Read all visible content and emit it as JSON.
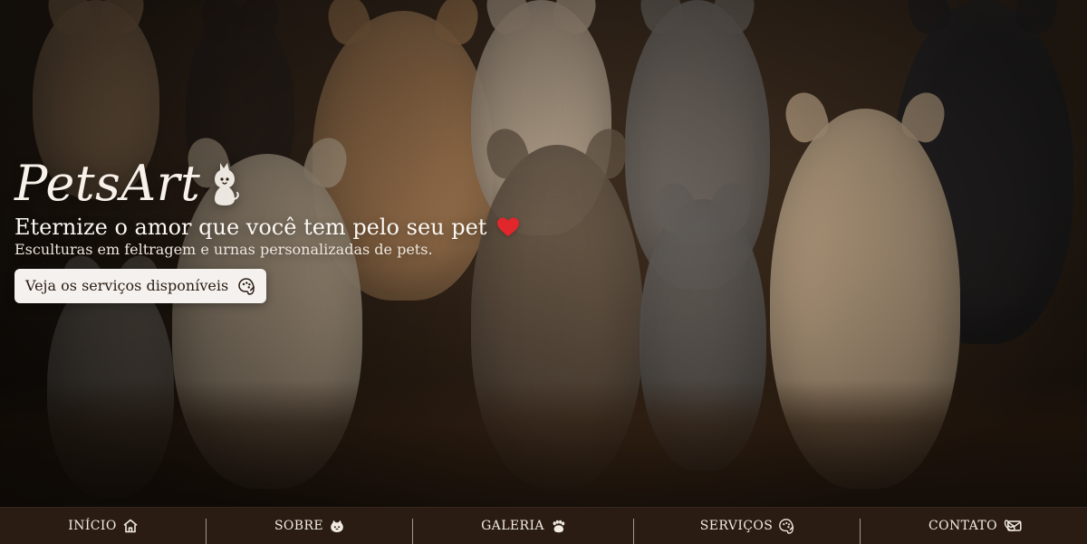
{
  "hero": {
    "brand": "PetsArt",
    "headline": "Eternize o amor que você tem pelo seu pet",
    "subheadline": "Esculturas em feltragem e urnas personalizadas de pets.",
    "cta_label": "Veja os serviços disponíveis",
    "icons": {
      "brand": "cat-icon",
      "headline": "heart-icon",
      "cta": "palette-icon"
    },
    "colors": {
      "heart": "#e1262c",
      "cta_background": "#f4f1ee",
      "nav_background": "#2a1c12"
    }
  },
  "nav": {
    "items": [
      {
        "label": "INÍCIO",
        "icon": "home-icon"
      },
      {
        "label": "SOBRE",
        "icon": "cat-face-icon"
      },
      {
        "label": "GALERIA",
        "icon": "paw-icon"
      },
      {
        "label": "SERVIÇOS",
        "icon": "palette-icon"
      },
      {
        "label": "CONTATO",
        "icon": "phone-mail-icon"
      }
    ]
  }
}
